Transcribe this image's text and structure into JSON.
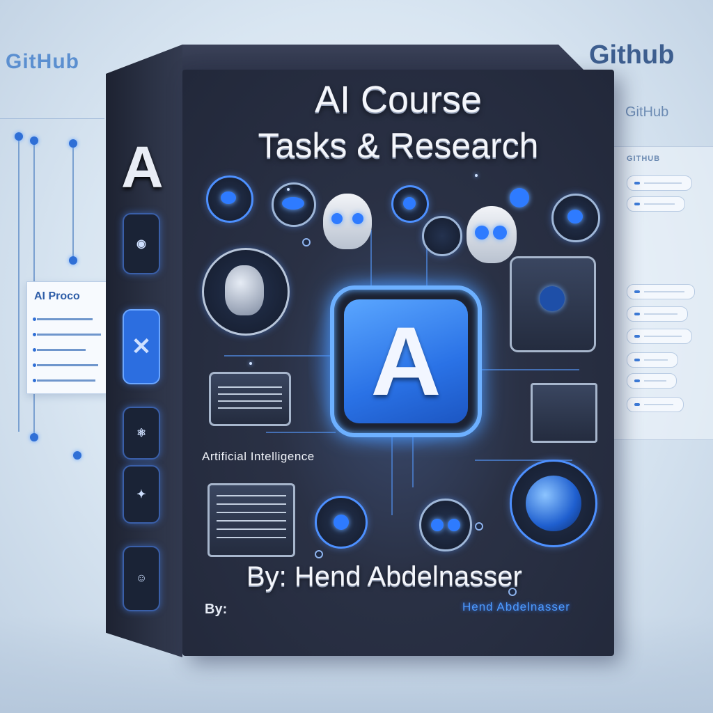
{
  "background": {
    "github_left": "GitHub",
    "github_right": "Github",
    "github_sub": "GitHub",
    "github_small": "GITHUB",
    "side_card_title": "AI Proco"
  },
  "box": {
    "title_line1": "AI Course",
    "title_line2": "Tasks & Research",
    "logo_letter": "A",
    "side_letter": "A",
    "caption": "Artificial Intelligence",
    "author_main": "By: Hend Abdelnasser",
    "author_sub": "Hend Abdelnasser",
    "by_small": "By:"
  },
  "colors": {
    "accent": "#2f6fd6",
    "glow": "#4d9bff",
    "box_dark": "#22283a"
  }
}
